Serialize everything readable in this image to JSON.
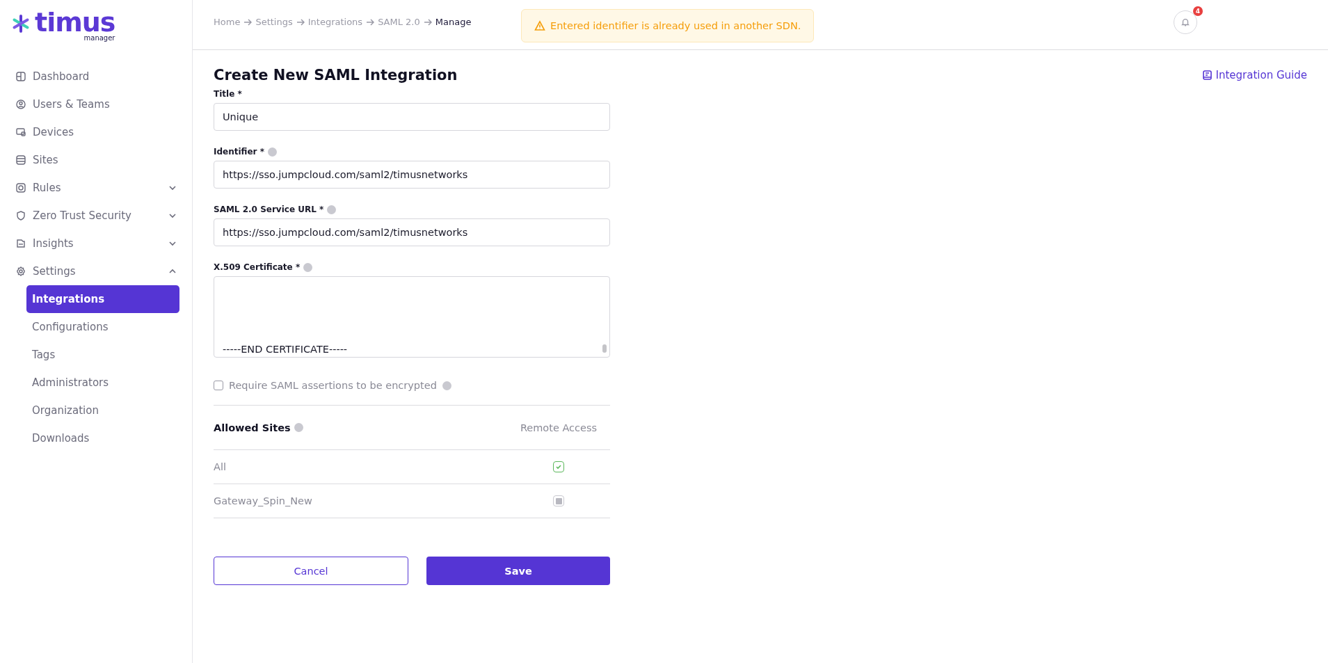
{
  "logo": {
    "name": "timus",
    "subtitle": "manager"
  },
  "sidebar": {
    "items": [
      {
        "label": "Dashboard",
        "kind": "link"
      },
      {
        "label": "Users & Teams",
        "kind": "link"
      },
      {
        "label": "Devices",
        "kind": "link"
      },
      {
        "label": "Sites",
        "kind": "link"
      },
      {
        "label": "Rules",
        "kind": "group",
        "expanded": false
      },
      {
        "label": "Zero Trust Security",
        "kind": "group",
        "expanded": false
      },
      {
        "label": "Insights",
        "kind": "group",
        "expanded": false
      },
      {
        "label": "Settings",
        "kind": "group",
        "expanded": true,
        "children": [
          {
            "label": "Integrations",
            "selected": true
          },
          {
            "label": "Configurations",
            "selected": false
          },
          {
            "label": "Tags",
            "selected": false
          },
          {
            "label": "Administrators",
            "selected": false
          },
          {
            "label": "Organization",
            "selected": false
          },
          {
            "label": "Downloads",
            "selected": false
          }
        ]
      }
    ]
  },
  "breadcrumb": [
    "Home",
    "Settings",
    "Integrations",
    "SAML 2.0",
    "Manage"
  ],
  "alert": {
    "text": "Entered identifier is already used in another SDN."
  },
  "notifications": {
    "count": "4"
  },
  "page": {
    "title": "Create New SAML Integration",
    "guide_link": "Integration Guide"
  },
  "fields": [
    {
      "label": "Title *",
      "kind": "input",
      "help": false,
      "value": "Unique"
    },
    {
      "label": "Identifier *",
      "kind": "input",
      "help": true,
      "value": "https://sso.jumpcloud.com/saml2/timusnetworks"
    },
    {
      "label": "SAML 2.0 Service URL *",
      "kind": "input",
      "help": true,
      "value": "https://sso.jumpcloud.com/saml2/timusnetworks"
    },
    {
      "label": "X.509 Certificate *",
      "kind": "textarea",
      "help": true,
      "value": "-----END CERTIFICATE-----"
    }
  ],
  "encrypt_option": {
    "label": "Require SAML assertions to be encrypted",
    "checked": false
  },
  "sites_table": {
    "columns": [
      "Allowed Sites",
      "Remote Access"
    ],
    "rows": [
      {
        "site": "All",
        "remote_access": true
      },
      {
        "site": "Gateway_Spin_New",
        "remote_access": false
      }
    ]
  },
  "buttons": [
    {
      "label": "Cancel",
      "kind": "secondary"
    },
    {
      "label": "Save",
      "kind": "primary"
    }
  ]
}
